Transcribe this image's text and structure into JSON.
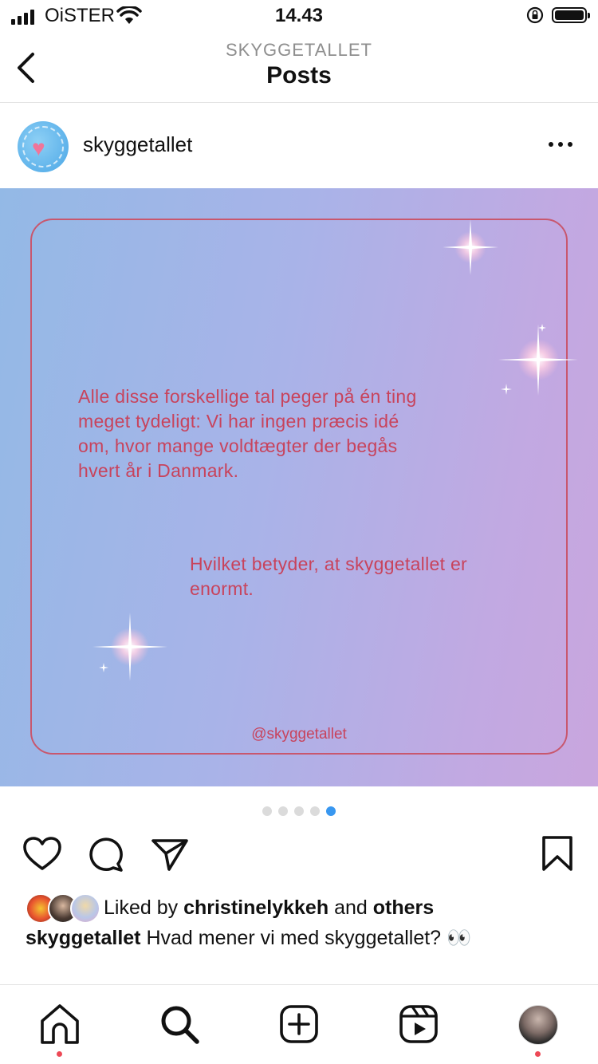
{
  "status_bar": {
    "carrier": "OiSTER",
    "time": "14.43"
  },
  "header": {
    "subtitle": "SKYGGETALLET",
    "title": "Posts"
  },
  "post": {
    "username": "skyggetallet",
    "image": {
      "paragraph1": "Alle disse forskellige tal peger på én ting meget tydeligt: Vi har ingen præcis idé om, hvor mange voldtægter der begås hvert år i Danmark.",
      "paragraph2": "Hvilket betyder, at skyggetallet er enormt.",
      "handle": "@skyggetallet"
    },
    "carousel": {
      "count": 5,
      "active_index": 5
    },
    "likes": {
      "prefix": "Liked by",
      "user": "christinelykkeh",
      "joiner": "and",
      "others": "others"
    },
    "caption": {
      "user": "skyggetallet",
      "text": "Hvad mener vi med skyggetallet? 👀"
    }
  },
  "colors": {
    "accent_text": "#c8435c",
    "active_dot": "#3897f0",
    "notification_dot": "#ed4956"
  },
  "icons": {
    "actions": [
      "heart-icon",
      "comment-icon",
      "share-icon",
      "bookmark-icon"
    ],
    "tabs": [
      "home-icon",
      "search-icon",
      "new-post-icon",
      "reels-icon",
      "profile-avatar"
    ]
  }
}
